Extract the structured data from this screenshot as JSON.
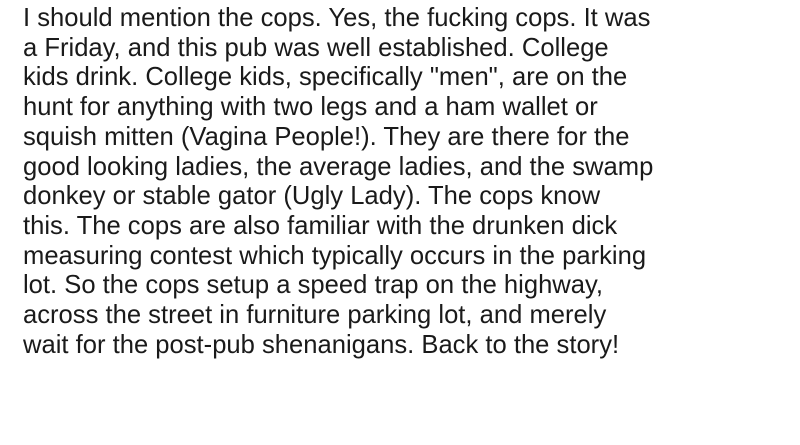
{
  "document": {
    "lines": [
      "I should mention the cops. Yes, the fucking cops. It was",
      "a Friday, and this pub was well established. College",
      "kids drink. College kids, specifically \"men\", are on the",
      "hunt for anything with two legs and a ham wallet or",
      "squish mitten (Vagina People!). They are there for the",
      "good looking ladies, the average ladies, and the swamp",
      "donkey or stable gator (Ugly Lady). The cops know",
      "this. The cops are also familiar with the drunken dick",
      "measuring contest which typically occurs in the parking",
      "lot. So the cops setup a speed trap on the highway,",
      "across the street in furniture parking lot, and merely",
      "wait for the post-pub shenanigans. Back to the story!"
    ]
  }
}
